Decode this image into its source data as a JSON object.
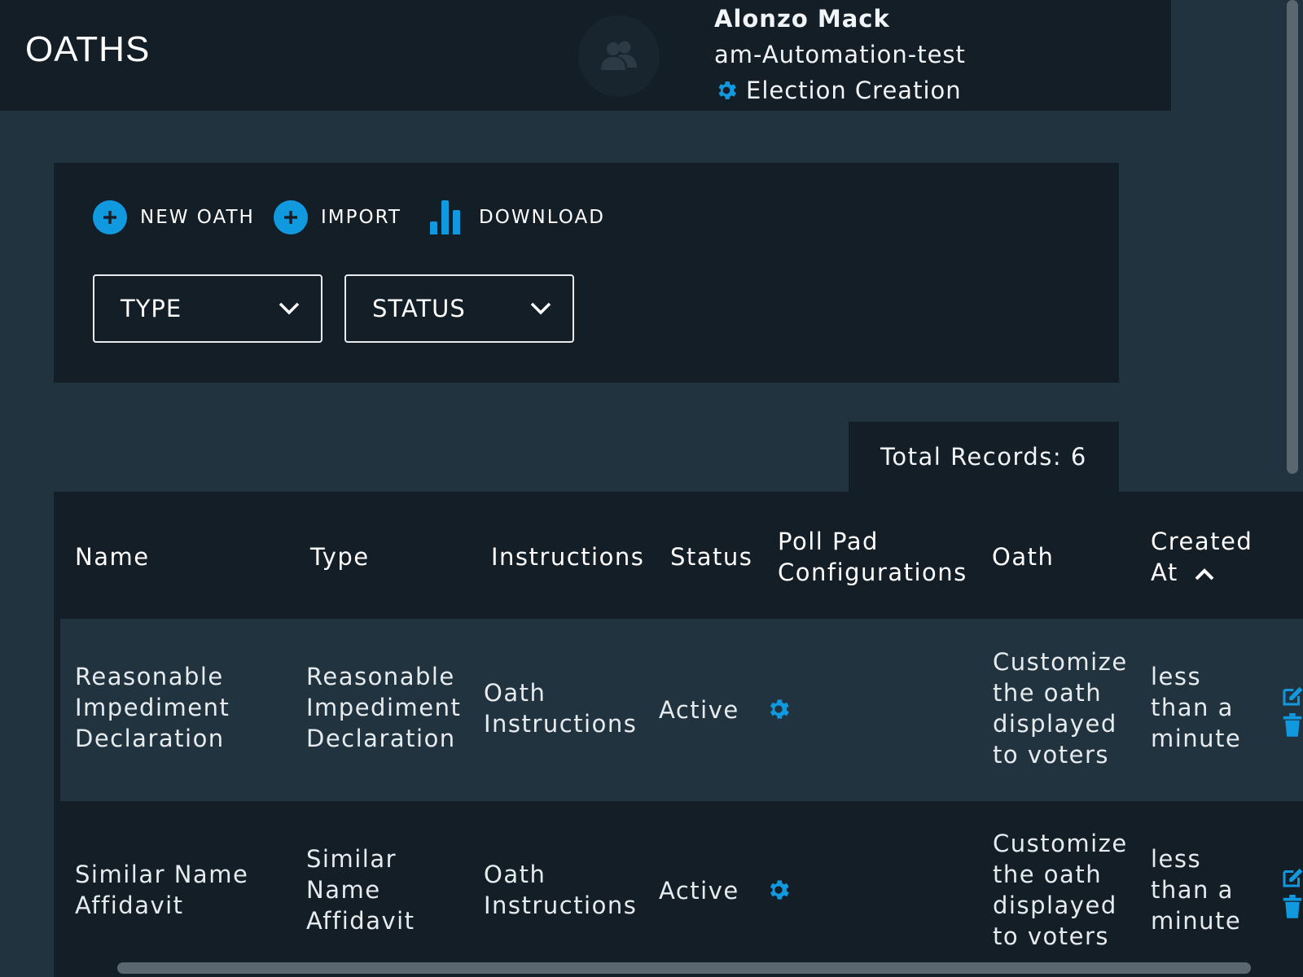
{
  "header": {
    "title": "OATHS",
    "user_name": "Alonzo Mack",
    "organization": "am-Automation-test",
    "role": "Election Creation"
  },
  "toolbar": {
    "new_oath_label": "NEW OATH",
    "import_label": "IMPORT",
    "download_label": "DOWNLOAD"
  },
  "filters": {
    "type_label": "TYPE",
    "status_label": "STATUS"
  },
  "total_records": "Total Records: 6",
  "table": {
    "columns": {
      "name": "Name",
      "type": "Type",
      "instructions": "Instructions",
      "status": "Status",
      "poll_pad": "Poll Pad Configurations",
      "oath": "Oath",
      "created_at": "Created At"
    },
    "rows": [
      {
        "name": "Reasonable Impediment Declaration",
        "type": "Reasonable Impediment Declaration",
        "instructions": "Oath Instructions",
        "status": "Active",
        "oath": "Customize the oath displayed to voters",
        "created_at": "less than a minute"
      },
      {
        "name": "Similar Name Affidavit",
        "type": "Similar Name Affidavit",
        "instructions": "Oath Instructions",
        "status": "Active",
        "oath": "Customize the oath displayed to voters",
        "created_at": "less than a minute"
      }
    ]
  },
  "colors": {
    "accent": "#1199e0",
    "header_bg": "#141e27",
    "page_bg": "#223340"
  },
  "icons": [
    "users-icon",
    "gear-icon",
    "plus-circle-icon",
    "bar-chart-icon",
    "chevron-down-icon",
    "chevron-up-icon",
    "edit-icon",
    "trash-icon"
  ]
}
